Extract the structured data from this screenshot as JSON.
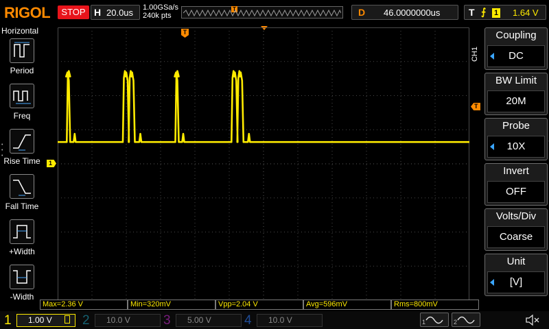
{
  "brand": "RIGOL",
  "run_state": "STOP",
  "horizontal": {
    "key": "H",
    "timebase": "20.0us"
  },
  "acquisition": {
    "sample_rate": "1.00GSa/s",
    "memory_depth": "240k pts",
    "trigger_marker": "T"
  },
  "delay": {
    "key": "D",
    "value": "46.0000000us"
  },
  "trigger": {
    "key": "T",
    "slope_icon": "rising-edge-icon",
    "source": "1",
    "level": "1.64 V"
  },
  "left_panel": {
    "title": "Horizontal",
    "items": [
      {
        "label": "Period",
        "icon": "period-icon"
      },
      {
        "label": "Freq",
        "icon": "frequency-icon"
      },
      {
        "label": "Rise Time",
        "icon": "rise-time-icon"
      },
      {
        "label": "Fall Time",
        "icon": "fall-time-icon"
      },
      {
        "label": "+Width",
        "icon": "positive-width-icon"
      },
      {
        "label": "-Width",
        "icon": "negative-width-icon"
      }
    ]
  },
  "markers": {
    "ch1": "1",
    "trigger": "T",
    "trigger_level": "T"
  },
  "right_menu": {
    "channel_tab": "CH1",
    "items": [
      {
        "title": "Coupling",
        "value": "DC",
        "has_arrow": true
      },
      {
        "title": "BW Limit",
        "value": "20M",
        "has_arrow": false
      },
      {
        "title": "Probe",
        "value": "10X",
        "has_arrow": true
      },
      {
        "title": "Invert",
        "value": "OFF",
        "has_arrow": false
      },
      {
        "title": "Volts/Div",
        "value": "Coarse",
        "has_arrow": false
      },
      {
        "title": "Unit",
        "value": "[V]",
        "has_arrow": true
      }
    ]
  },
  "measurements": [
    {
      "label": "Max=2.36 V"
    },
    {
      "label": "Min=320mV"
    },
    {
      "label": "Vpp=2.04 V"
    },
    {
      "label": "Avg=596mV"
    },
    {
      "label": "Rms=800mV"
    }
  ],
  "channels": [
    {
      "num": "1",
      "scale": "1.00 V",
      "color": "#ffeb00",
      "active": true
    },
    {
      "num": "2",
      "scale": "10.0 V",
      "color": "#1ea7c4",
      "active": false
    },
    {
      "num": "3",
      "scale": "5.00 V",
      "color": "#d02bd8",
      "active": false
    },
    {
      "num": "4",
      "scale": "10.0 V",
      "color": "#2a6fe0",
      "active": false
    }
  ],
  "colors": {
    "ch1": "#ffeb00",
    "trigger": "#ff8a00",
    "grid": "#4a4a4a",
    "menu_arrow": "#3aa6ff"
  },
  "waveform": {
    "channel": "1",
    "volts_per_div": 1.0,
    "time_per_div_us": 20,
    "baseline_v": 0.4,
    "pulse_high_v": 2.36,
    "pulse_groups": [
      {
        "start_us": 5.3,
        "widths_us": [
          1.2
        ]
      },
      {
        "start_us": 38.0,
        "widths_us": [
          2.8,
          2.8
        ],
        "gap_us": 0.6
      },
      {
        "start_us": 68.6,
        "widths_us": [
          1.2
        ]
      },
      {
        "start_us": 101.3,
        "widths_us": [
          2.8,
          2.8
        ],
        "gap_us": 0.6
      }
    ]
  },
  "bottom_icons": {
    "wave_a": "sine-wave-1-icon",
    "wave_b": "sine-wave-2-icon",
    "speaker": "speaker-muted-icon"
  }
}
